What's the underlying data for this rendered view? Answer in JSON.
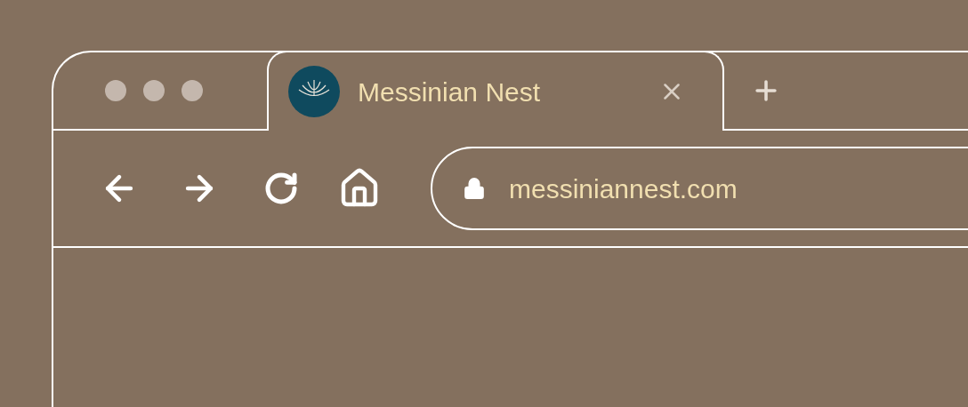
{
  "tabs": [
    {
      "title": "Messinian Nest",
      "selected": true
    }
  ],
  "address_bar": {
    "url": "messiniannest.com"
  }
}
